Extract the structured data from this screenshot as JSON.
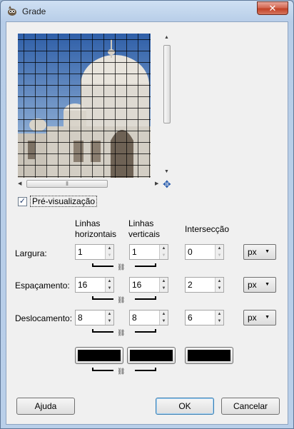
{
  "window": {
    "title": "Grade",
    "close_glyph": "✕"
  },
  "preview": {
    "scroll_up": "▲",
    "scroll_down": "▼",
    "scroll_left": "◀",
    "scroll_right": "▶",
    "grip": "⦀",
    "navigate_glyph": "✥",
    "checkbox_checked_glyph": "✓",
    "checkbox_label": "Pré-visualização",
    "checked": true
  },
  "columns": {
    "horizontal_line1": "Linhas",
    "horizontal_line2": "horizontais",
    "vertical_line1": "Linhas",
    "vertical_line2": "verticais",
    "intersection": "Intersecção"
  },
  "rows": {
    "width": {
      "label": "Largura:",
      "horizontal": "1",
      "vertical": "1",
      "intersection": "0",
      "unit": "px"
    },
    "spacing": {
      "label": "Espaçamento:",
      "horizontal": "16",
      "vertical": "16",
      "intersection": "2",
      "unit": "px"
    },
    "offset": {
      "label": "Deslocamento:",
      "horizontal": "8",
      "vertical": "8",
      "intersection": "6",
      "unit": "px"
    }
  },
  "spin": {
    "up": "▲",
    "down": "▼"
  },
  "unit_caret": "▼",
  "chain_glyph": "⛓",
  "colors": {
    "horizontal": "#000000",
    "vertical": "#000000",
    "intersection": "#000000"
  },
  "buttons": {
    "help": "Ajuda",
    "ok": "OK",
    "cancel": "Cancelar"
  }
}
